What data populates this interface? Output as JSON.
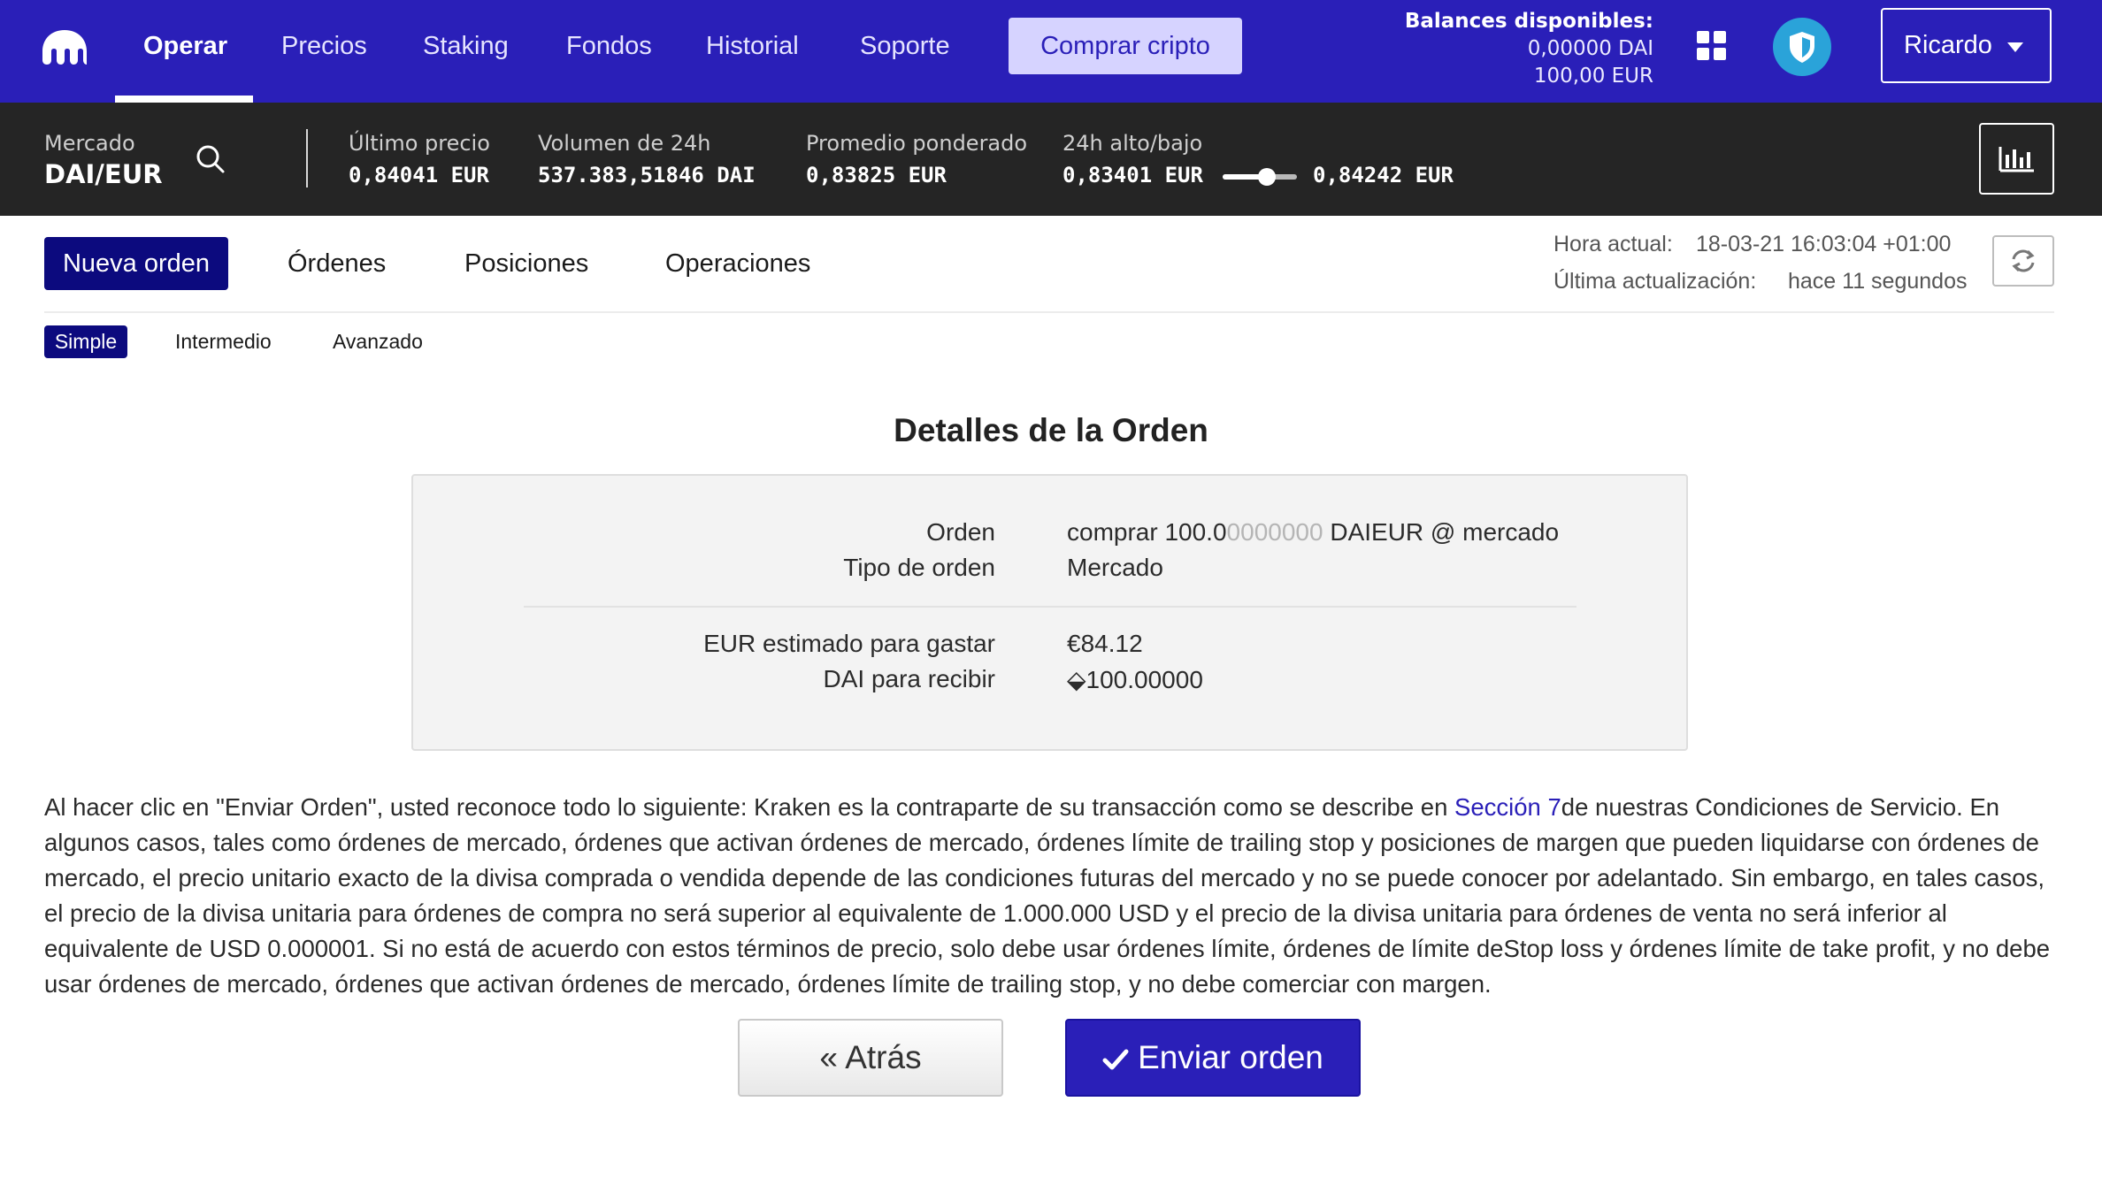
{
  "topnav": {
    "items": [
      {
        "label": "Operar",
        "active": true
      },
      {
        "label": "Precios"
      },
      {
        "label": "Staking"
      },
      {
        "label": "Fondos"
      },
      {
        "label": "Historial"
      },
      {
        "label": "Soporte"
      }
    ],
    "buy_label": "Comprar cripto",
    "balances_title": "Balances disponibles:",
    "balance_dai": "0,00000 DAI",
    "balance_eur": "100,00 EUR",
    "user_name": "Ricardo",
    "icons": {
      "logo": "kraken-logo",
      "apps": "grid-icon",
      "security": "shield-icon",
      "user_menu": "caret-down-icon"
    }
  },
  "market": {
    "label": "Mercado",
    "pair": "DAI/EUR",
    "last_price_label": "Último precio",
    "last_price": "0,84041 EUR",
    "volume_label": "Volumen de 24h",
    "volume": "537.383,51846 DAI",
    "vwap_label": "Promedio ponderado",
    "vwap": "0,83825 EUR",
    "range_label": "24h alto/bajo",
    "low": "0,83401 EUR",
    "high": "0,84242 EUR",
    "range_position": 0.6
  },
  "tabs": [
    "Nueva orden",
    "Órdenes",
    "Posiciones",
    "Operaciones"
  ],
  "time": {
    "current_label": "Hora actual:",
    "current_value": "18-03-21 16:03:04 +01:00",
    "updated_label": "Última actualización:",
    "updated_value": "hace 11 segundos"
  },
  "modes": [
    "Simple",
    "Intermedio",
    "Avanzado"
  ],
  "details": {
    "title": "Detalles de la Orden",
    "order_label": "Orden",
    "order_prefix": "comprar 100.0",
    "order_muted": "0000000",
    "order_suffix": " DAIEUR @ mercado",
    "type_label": "Tipo de orden",
    "type_value": "Mercado",
    "spend_label": "EUR estimado para gastar",
    "spend_value": "€84.12",
    "receive_label": "DAI para recibir",
    "receive_value": "⬙100.00000"
  },
  "legal": {
    "before_link": "Al hacer clic en \"Enviar Orden\", usted reconoce todo lo siguiente: Kraken es la contraparte de su transacción como se describe en ",
    "link": "Sección 7",
    "after_link": "de nuestras Condiciones de Servicio. En algunos casos, tales como órdenes de mercado, órdenes que activan órdenes de mercado, órdenes límite de trailing stop y posiciones de margen que pueden liquidarse con órdenes de mercado, el precio unitario exacto de la divisa comprada o vendida depende de las condiciones futuras del mercado y no se puede conocer por adelantado. Sin embargo, en tales casos, el precio de la divisa unitaria para órdenes de compra no será superior al equivalente de 1.000.000 USD y el precio de la divisa unitaria para órdenes de venta no será inferior al equivalente de USD 0.000001. Si no está de acuerdo con estos términos de precio, solo debe usar órdenes límite, órdenes de límite deStop loss y órdenes límite de take profit, y no debe usar órdenes de mercado, órdenes que activan órdenes de mercado, órdenes límite de trailing stop, y no debe comerciar con margen."
  },
  "actions": {
    "back_label": "« Atrás",
    "submit_label": "Enviar orden"
  },
  "colors": {
    "brand": "#2a1fb8",
    "tab_active": "#0c0a7e",
    "market_bar": "#252525",
    "security": "#2aa3d9"
  }
}
